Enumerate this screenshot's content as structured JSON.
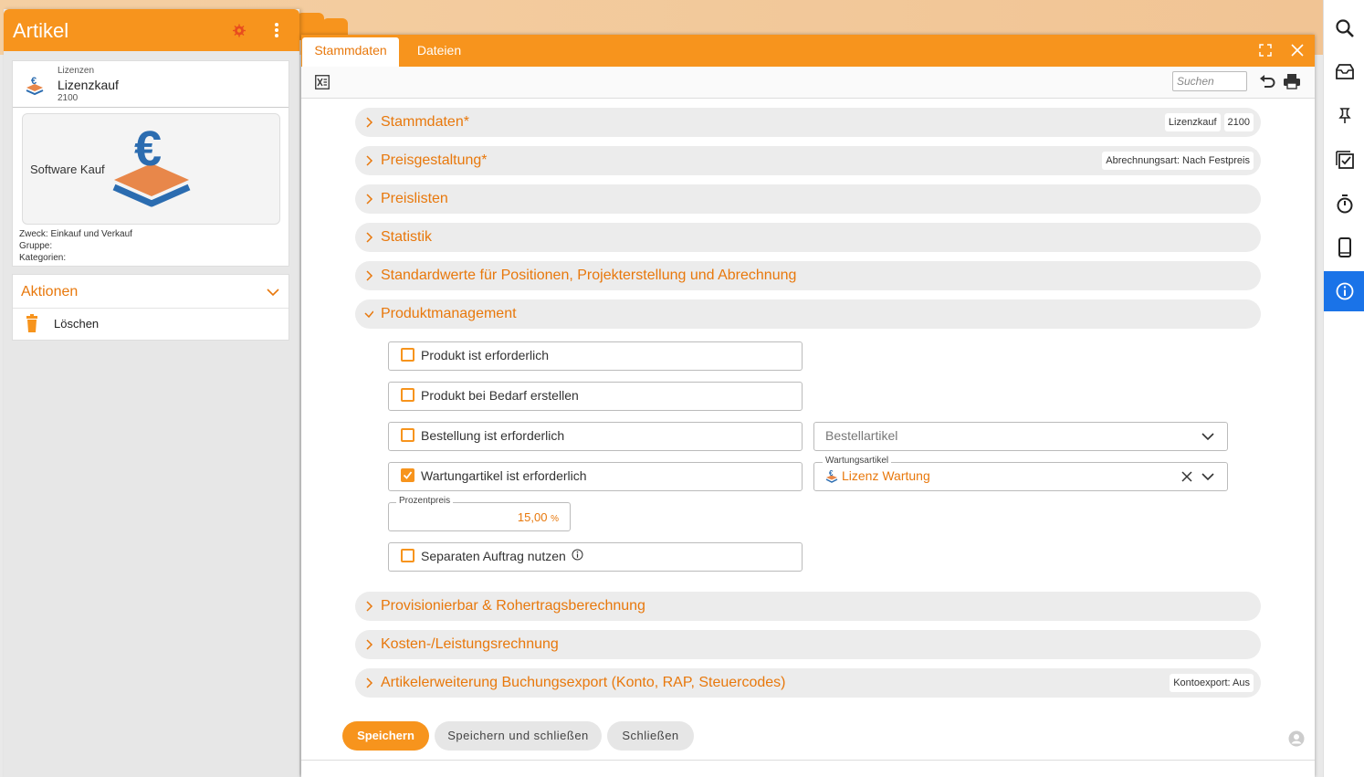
{
  "left_panel": {
    "title": "Artikel",
    "article": {
      "category": "Lizenzen",
      "name": "Lizenzkauf",
      "number": "2100",
      "image_label": "Software Kauf",
      "zweck": "Zweck: Einkauf und Verkauf",
      "gruppe": "Gruppe:",
      "kategorien": "Kategorien:"
    },
    "actions": {
      "title": "Aktionen",
      "items": [
        {
          "label": "Löschen",
          "icon": "trash-icon"
        }
      ]
    }
  },
  "main": {
    "tabs": [
      {
        "label": "Stammdaten",
        "active": true
      },
      {
        "label": "Dateien",
        "active": false
      }
    ],
    "search": {
      "placeholder": "Suchen",
      "value": ""
    },
    "sections": [
      {
        "title": "Stammdaten*",
        "expanded": false,
        "badges": [
          "Lizenzkauf",
          "2100"
        ]
      },
      {
        "title": "Preisgestaltung*",
        "expanded": false,
        "badges": [
          "Abrechnungsart: Nach Festpreis"
        ]
      },
      {
        "title": "Preislisten",
        "expanded": false,
        "badges": []
      },
      {
        "title": "Statistik",
        "expanded": false,
        "badges": []
      },
      {
        "title": "Standardwerte für Positionen, Projekterstellung und Abrechnung",
        "expanded": false,
        "badges": []
      },
      {
        "title": "Produktmanagement",
        "expanded": true,
        "badges": []
      },
      {
        "title": "Provisionierbar & Rohertragsberechnung",
        "expanded": false,
        "badges": []
      },
      {
        "title": "Kosten-/Leistungsrechnung",
        "expanded": false,
        "badges": []
      },
      {
        "title": "Artikelerweiterung Buchungsexport (Konto, RAP, Steuercodes)",
        "expanded": false,
        "badges": [
          "Kontoexport: Aus"
        ]
      }
    ],
    "produktmanagement": {
      "checkboxes": [
        {
          "label": "Produkt ist erforderlich",
          "checked": false
        },
        {
          "label": "Produkt bei Bedarf erstellen",
          "checked": false
        },
        {
          "label": "Bestellung ist erforderlich",
          "checked": false
        },
        {
          "label": "Wartungartikel ist erforderlich",
          "checked": true
        },
        {
          "label": "Separaten Auftrag nutzen",
          "checked": false
        }
      ],
      "bestellartikel": {
        "placeholder": "Bestellartikel",
        "value": ""
      },
      "wartungsartikel": {
        "label": "Wartungsartikel",
        "value": "Lizenz Wartung"
      },
      "prozentpreis": {
        "label": "Prozentpreis",
        "value": "15,00",
        "unit": "%"
      }
    },
    "buttons": {
      "save": "Speichern",
      "save_close": "Speichern und schließen",
      "close": "Schließen"
    }
  },
  "right_rail": {
    "icons": [
      "search-icon",
      "inbox-icon",
      "pin-icon",
      "tasks-icon",
      "timer-icon",
      "phone-icon",
      "info-icon"
    ],
    "active": "info-icon"
  },
  "colors": {
    "accent": "#f7941d",
    "accent_text": "#e8780c",
    "rail_active": "#1a73e8"
  }
}
